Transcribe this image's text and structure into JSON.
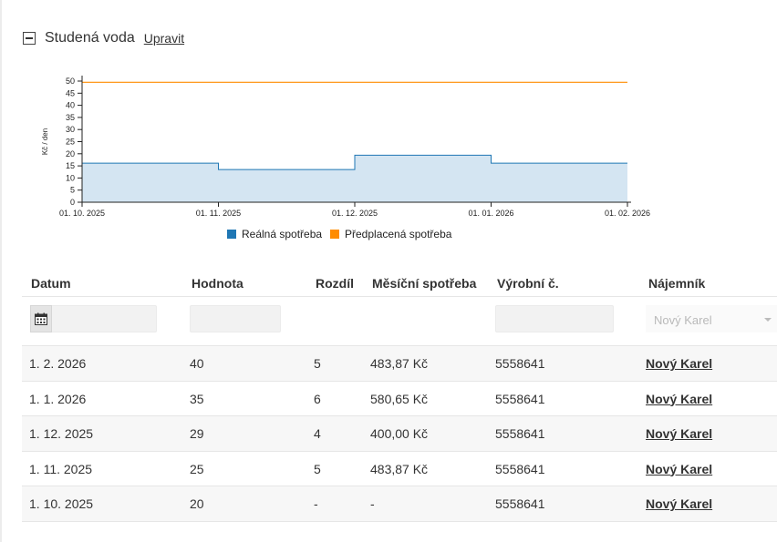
{
  "section": {
    "title": "Studená voda",
    "edit_label": "Upravit"
  },
  "chart_data": {
    "type": "area",
    "title": "",
    "xlabel": "",
    "ylabel": "Kč / den",
    "ylim": [
      0,
      50
    ],
    "yticks": [
      0,
      5,
      10,
      15,
      20,
      25,
      30,
      35,
      40,
      45,
      50
    ],
    "xticks": [
      "01. 10. 2025",
      "01. 11. 2025",
      "01. 12. 2025",
      "01. 01. 2026",
      "01. 02. 2026"
    ],
    "grid": false,
    "legend_position": "bottom",
    "series": [
      {
        "name": "Reálná spotřeba",
        "type": "step-area",
        "color": "#1f77b4",
        "fill": "#d4e5f2",
        "values": [
          16.1,
          13.5,
          19.4,
          16.1
        ]
      },
      {
        "name": "Předplacená spotřeba",
        "type": "line",
        "color": "#ff8c00",
        "values": [
          49.5,
          49.5,
          49.5,
          49.5,
          49.5
        ]
      }
    ]
  },
  "table": {
    "columns": [
      "Datum",
      "Hodnota",
      "Rozdíl",
      "Měsíční spotřeba",
      "Výrobní č.",
      "Nájemník"
    ],
    "filters": {
      "tenant_selected": "Nový Karel"
    },
    "rows": [
      {
        "date": "1. 2. 2026",
        "value": "40",
        "diff": "5",
        "monthly": "483,87 Kč",
        "serial": "5558641",
        "tenant": "Nový Karel"
      },
      {
        "date": "1. 1. 2026",
        "value": "35",
        "diff": "6",
        "monthly": "580,65 Kč",
        "serial": "5558641",
        "tenant": "Nový Karel"
      },
      {
        "date": "1. 12. 2025",
        "value": "29",
        "diff": "4",
        "monthly": "400,00 Kč",
        "serial": "5558641",
        "tenant": "Nový Karel"
      },
      {
        "date": "1. 11. 2025",
        "value": "25",
        "diff": "5",
        "monthly": "483,87 Kč",
        "serial": "5558641",
        "tenant": "Nový Karel"
      },
      {
        "date": "1. 10. 2025",
        "value": "20",
        "diff": "-",
        "monthly": "-",
        "serial": "5558641",
        "tenant": "Nový Karel"
      }
    ]
  },
  "icons": {
    "collapse": "minus-square-icon",
    "calendar": "calendar-icon",
    "dropdown": "chevron-down-icon"
  }
}
